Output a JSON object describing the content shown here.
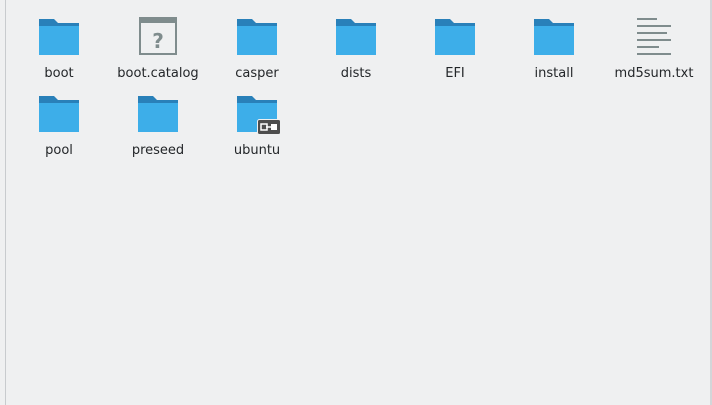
{
  "files": [
    {
      "name": "boot",
      "icon": "folder-icon"
    },
    {
      "name": "boot.catalog",
      "icon": "unknown-file-icon"
    },
    {
      "name": "casper",
      "icon": "folder-icon"
    },
    {
      "name": "dists",
      "icon": "folder-icon"
    },
    {
      "name": "EFI",
      "icon": "folder-icon"
    },
    {
      "name": "install",
      "icon": "folder-icon"
    },
    {
      "name": "md5sum.txt",
      "icon": "text-file-icon"
    },
    {
      "name": "pool",
      "icon": "folder-icon"
    },
    {
      "name": "preseed",
      "icon": "folder-icon"
    },
    {
      "name": "ubuntu",
      "icon": "folder-symlink-icon"
    }
  ],
  "colors": {
    "folder_front": "#3daee9",
    "folder_back": "#2980b9",
    "folder_tab": "#1d6fa0",
    "background": "#eff0f1",
    "text": "#232629"
  }
}
